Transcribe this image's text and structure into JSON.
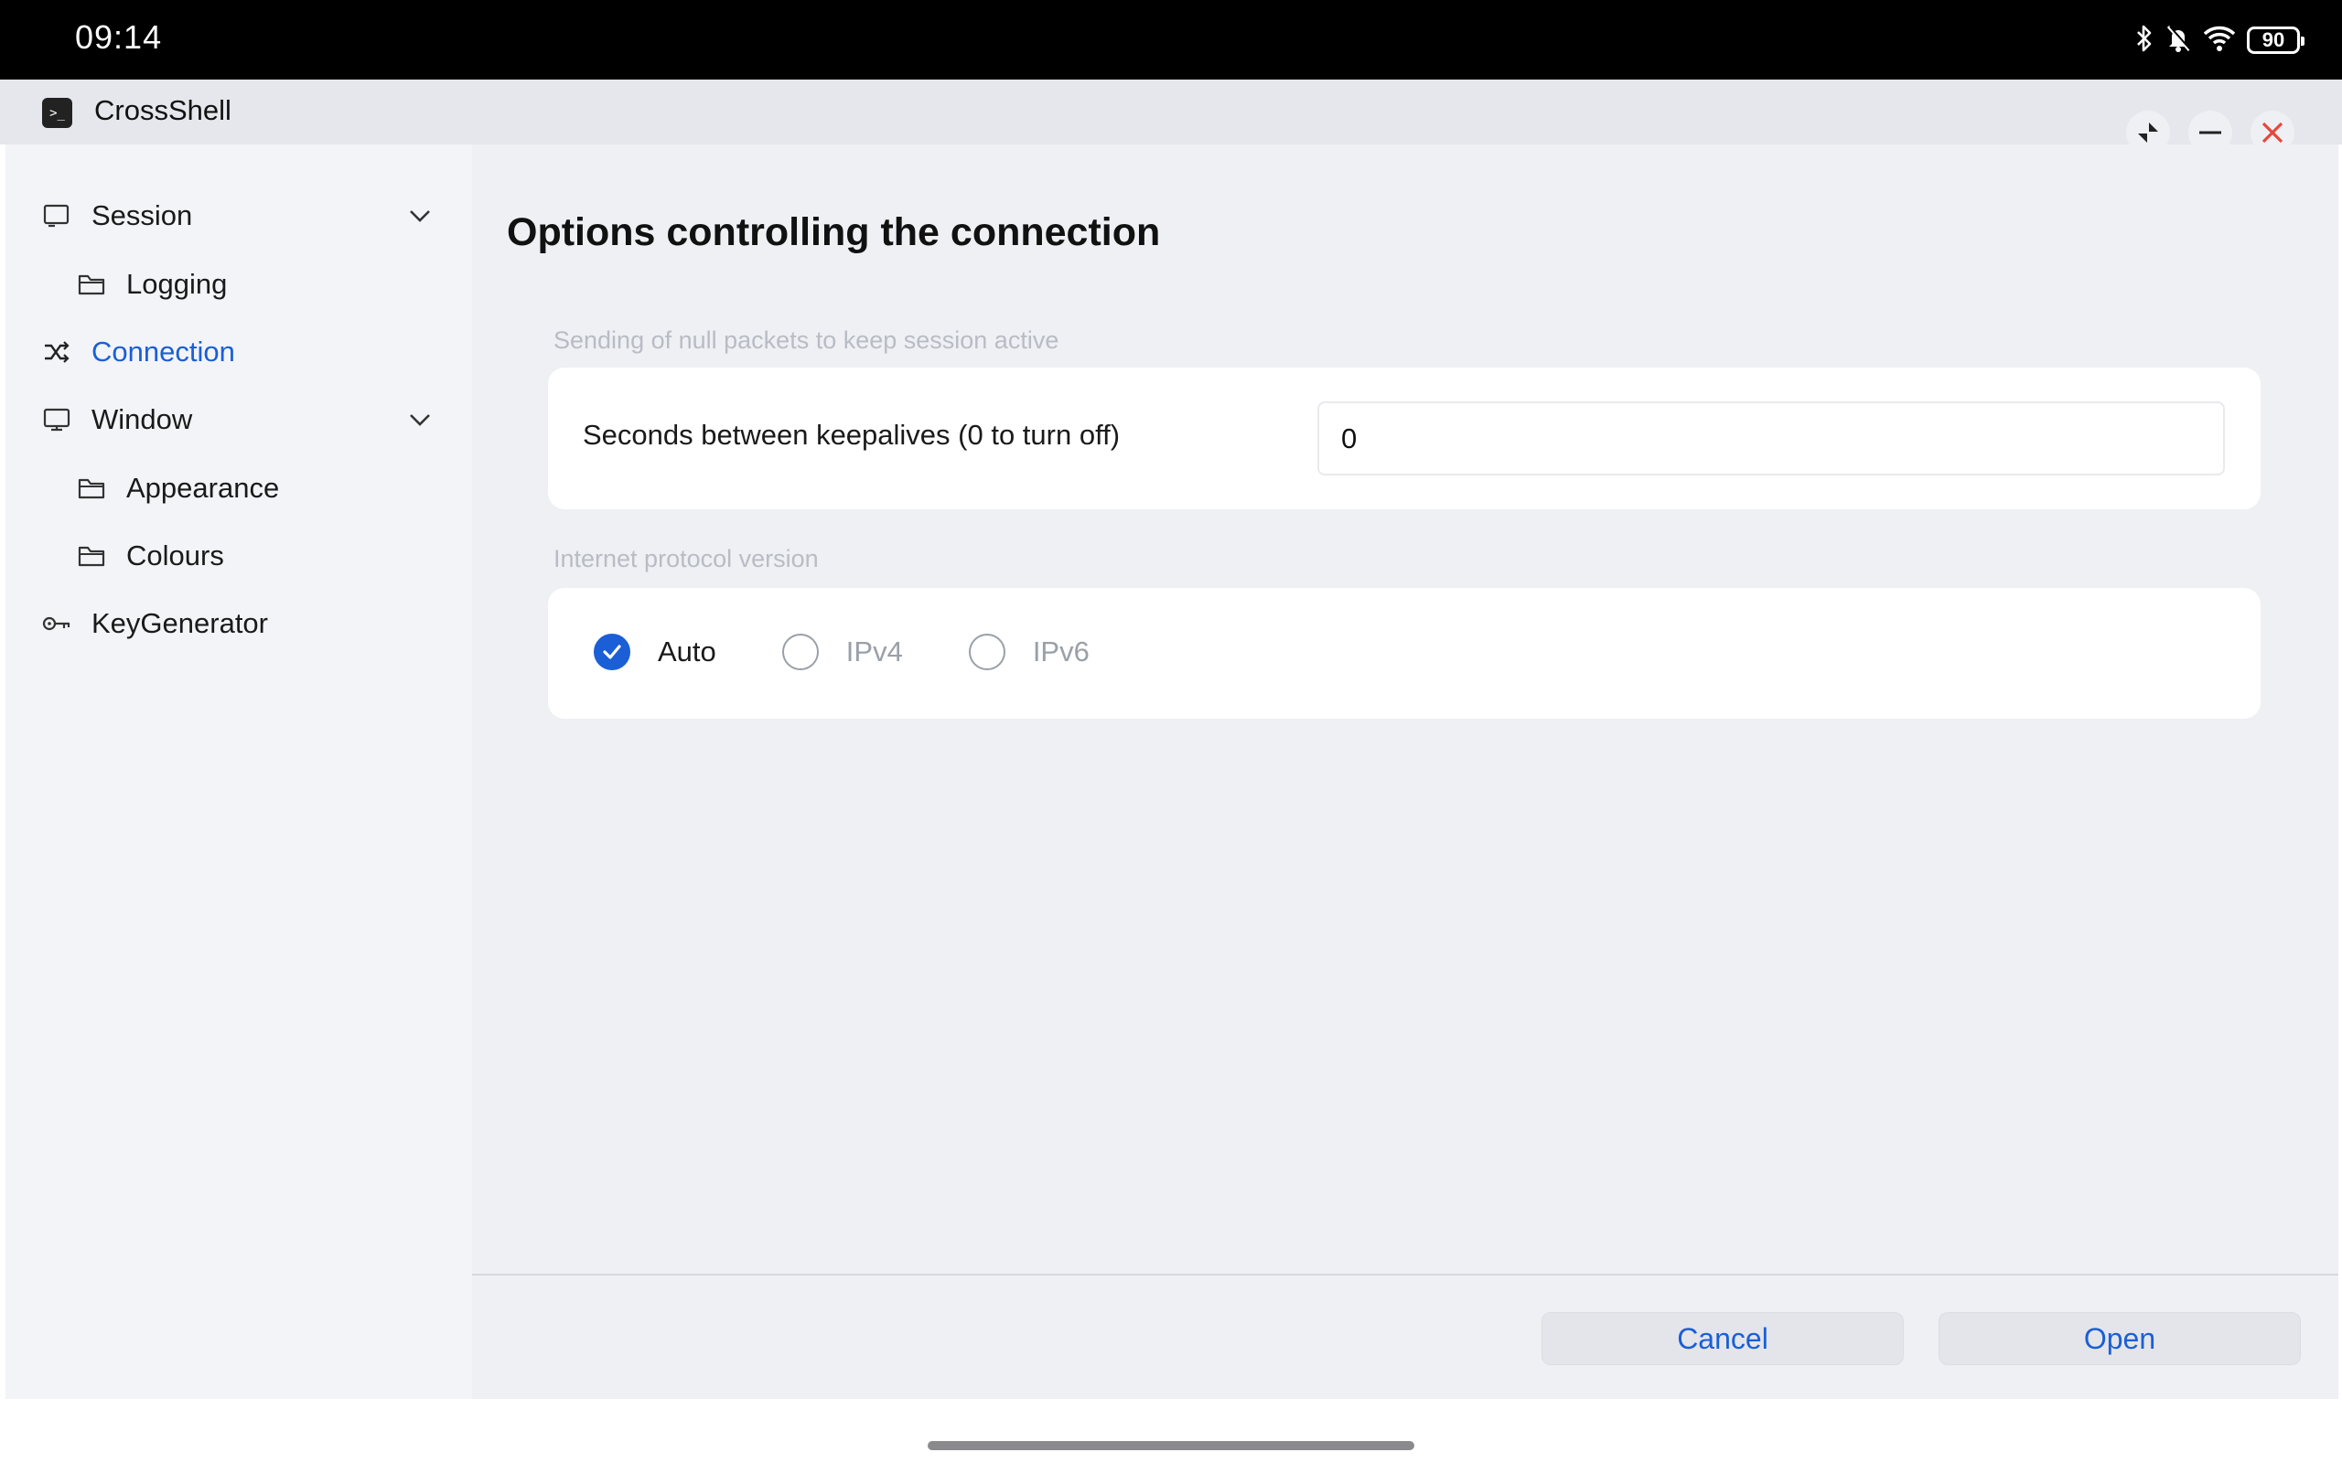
{
  "status_bar": {
    "time": "09:14",
    "battery": "90",
    "icons": [
      "bluetooth-icon",
      "bell-muted-icon",
      "wifi-icon",
      "battery-icon"
    ]
  },
  "app": {
    "title": "CrossShell",
    "icon": "terminal-icon",
    "window_controls": [
      "restore-icon",
      "minimize-icon",
      "close-icon"
    ],
    "accent_color": "#1a5fd6",
    "close_color": "#e5483b"
  },
  "sidebar": {
    "items": [
      {
        "label": "Session",
        "icon": "monitor-icon",
        "expandable": true
      },
      {
        "label": "Logging",
        "icon": "folder-icon"
      },
      {
        "label": "Connection",
        "icon": "shuffle-icon",
        "active": true
      },
      {
        "label": "Window",
        "icon": "display-icon",
        "expandable": true
      },
      {
        "label": "Appearance",
        "icon": "folder-icon"
      },
      {
        "label": "Colours",
        "icon": "folder-icon"
      },
      {
        "label": "KeyGenerator",
        "icon": "key-icon"
      }
    ]
  },
  "main": {
    "title": "Options controlling the connection",
    "keepalive": {
      "caption": "Sending of null packets to keep session active",
      "label": "Seconds between keepalives (0 to turn off)",
      "value": "0"
    },
    "protocol": {
      "caption": "Internet protocol version",
      "options": [
        {
          "label": "Auto",
          "checked": true
        },
        {
          "label": "IPv4",
          "checked": false
        },
        {
          "label": "IPv6",
          "checked": false
        }
      ]
    }
  },
  "footer": {
    "cancel_label": "Cancel",
    "open_label": "Open"
  }
}
